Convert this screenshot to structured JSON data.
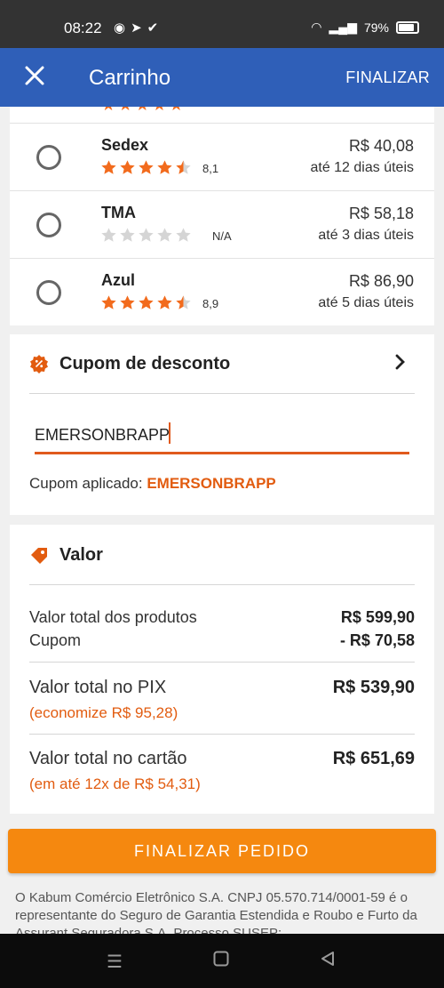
{
  "status_bar": {
    "time": "08:22",
    "battery": "79%"
  },
  "appbar": {
    "title": "Carrinho",
    "action": "FINALIZAR"
  },
  "shipping": {
    "options": [
      {
        "name": "Sedex",
        "rating": "8,1",
        "stars": 4.5,
        "price": "R$ 40,08",
        "delivery": "até 12 dias úteis"
      },
      {
        "name": "TMA",
        "rating": "N/A",
        "stars": 0,
        "price": "R$ 58,18",
        "delivery": "até 3 dias úteis"
      },
      {
        "name": "Azul",
        "rating": "8,9",
        "stars": 4.5,
        "price": "R$ 86,90",
        "delivery": "até 5 dias úteis"
      }
    ]
  },
  "coupon": {
    "title": "Cupom de desconto",
    "input_value": "EMERSONBRAPP",
    "applied_label": "Cupom aplicado:",
    "applied_code": "EMERSONBRAPP"
  },
  "value": {
    "title": "Valor",
    "products_label": "Valor total dos produtos",
    "products_value": "R$ 599,90",
    "coupon_label": "Cupom",
    "coupon_value": "- R$ 70,58",
    "pix_label": "Valor total no PIX",
    "pix_value": "R$ 539,90",
    "pix_note": "(economize R$ 95,28)",
    "card_label": "Valor total no cartão",
    "card_value": "R$ 651,69",
    "card_note": "(em até 12x de R$ 54,31)"
  },
  "cta": {
    "label": "FINALIZAR PEDIDO"
  },
  "legal": {
    "text": "O Kabum Comércio Eletrônico S.A. CNPJ 05.570.714/0001-59 é o representante do Seguro de Garantia Estendida e Roubo e Furto da Assurant Seguradora S.A. Processo SUSEP:"
  },
  "colors": {
    "appbar": "#2f5fb8",
    "accent": "#e25c10",
    "cta": "#f5880f",
    "star": "#f26b1d"
  }
}
